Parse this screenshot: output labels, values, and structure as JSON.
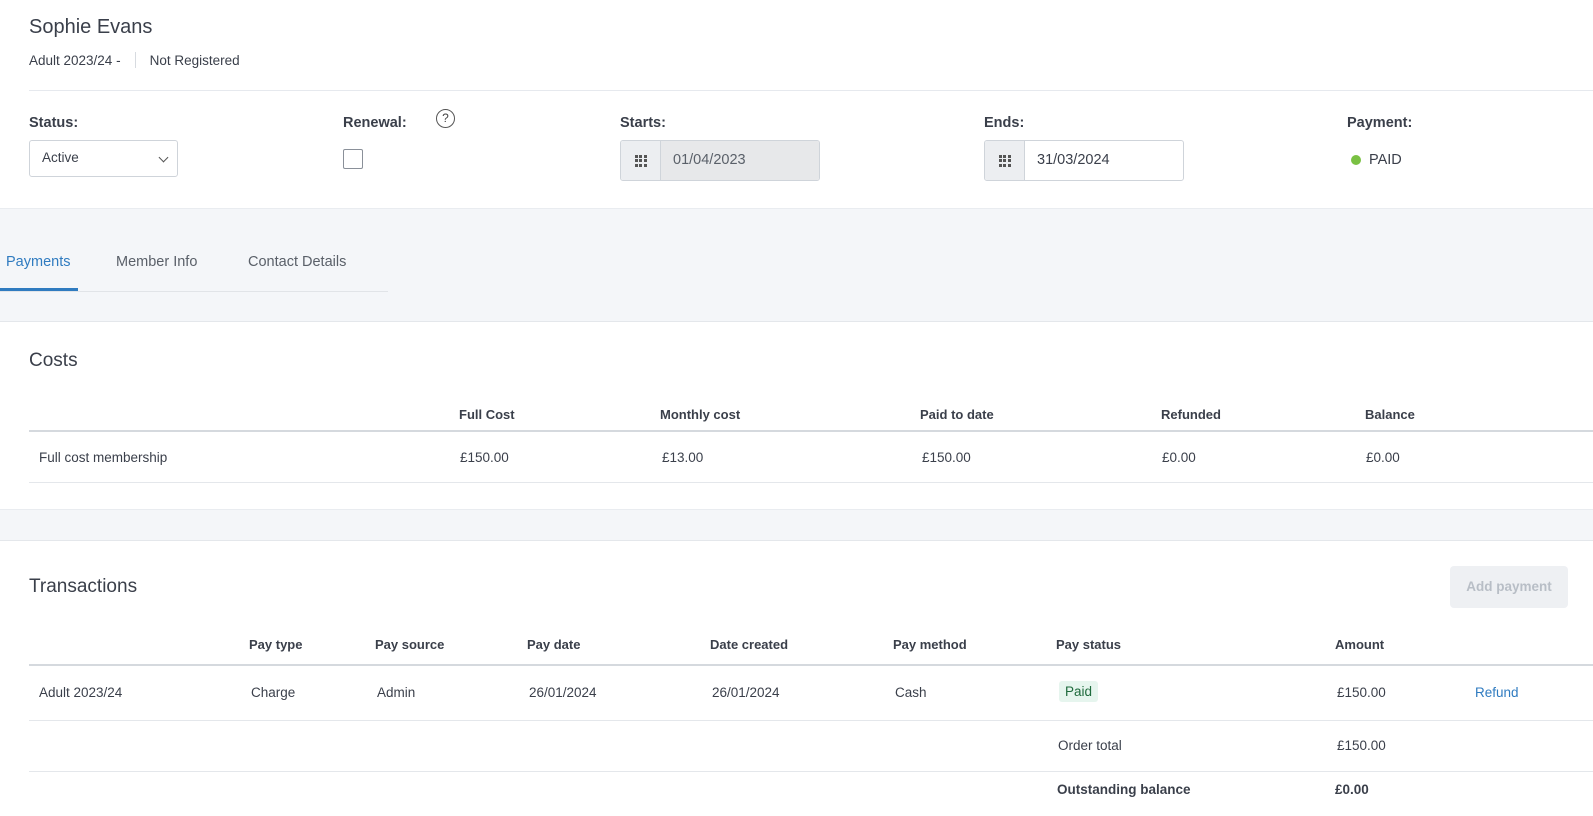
{
  "header": {
    "name": "Sophie Evans",
    "membership": "Adult 2023/24 -",
    "registration": "Not Registered"
  },
  "fields": {
    "status_label": "Status:",
    "status_value": "Active",
    "renewal_label": "Renewal:",
    "renewal_checked": false,
    "starts_label": "Starts:",
    "starts_value": "01/04/2023",
    "ends_label": "Ends:",
    "ends_value": "31/03/2024",
    "payment_label": "Payment:",
    "payment_value": "PAID",
    "payment_color": "#7ac143"
  },
  "tabs": [
    {
      "label": "Payments",
      "active": true
    },
    {
      "label": "Member Info",
      "active": false
    },
    {
      "label": "Contact Details",
      "active": false
    }
  ],
  "costs": {
    "title": "Costs",
    "headers": [
      "Full Cost",
      "Monthly cost",
      "Paid to date",
      "Refunded",
      "Balance"
    ],
    "row": {
      "name": "Full cost membership",
      "cells": [
        "£150.00",
        "£13.00",
        "£150.00",
        "£0.00",
        "£0.00"
      ]
    }
  },
  "transactions": {
    "title": "Transactions",
    "add_button": "Add payment",
    "headers": [
      "Pay type",
      "Pay source",
      "Pay date",
      "Date created",
      "Pay method",
      "Pay status",
      "Amount"
    ],
    "row": {
      "name": "Adult 2023/24",
      "pay_type": "Charge",
      "pay_source": "Admin",
      "pay_date": "26/01/2024",
      "date_created": "26/01/2024",
      "pay_method": "Cash",
      "pay_status": "Paid",
      "amount": "£150.00",
      "action": "Refund"
    },
    "order_total_label": "Order total",
    "order_total_value": "£150.00",
    "outstanding_label": "Outstanding balance",
    "outstanding_value": "£0.00"
  },
  "colors": {
    "accent": "#2f7bc0",
    "paid_pill_bg": "#e6f5ee",
    "paid_pill_text": "#1f6b3d"
  },
  "icons": {
    "calendar": "calendar-grid-icon",
    "help": "question-circle-icon",
    "dropdown": "chevron-down-icon"
  }
}
